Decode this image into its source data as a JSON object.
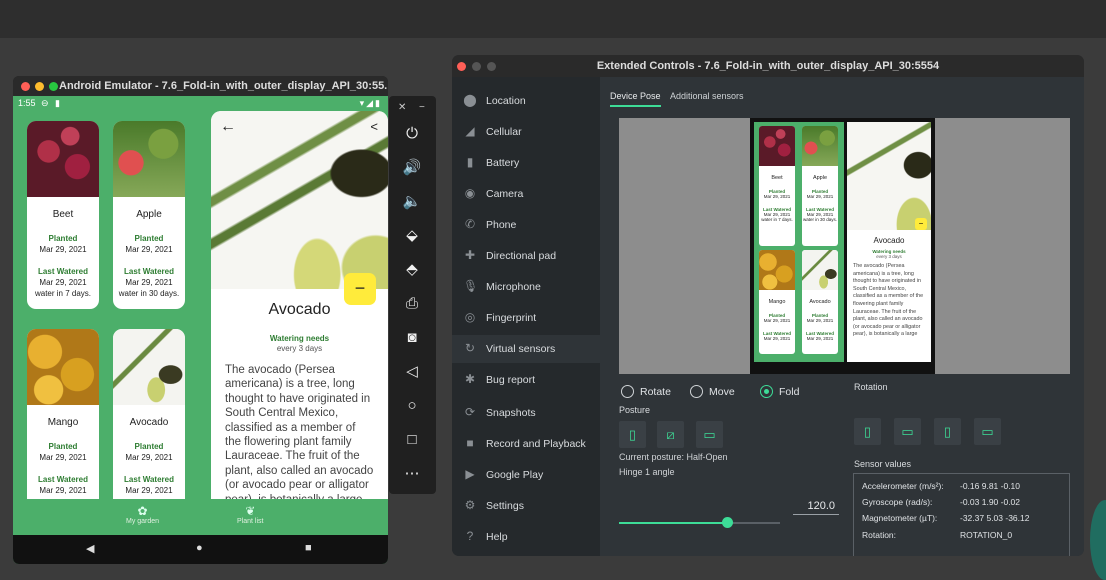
{
  "emulator": {
    "title": "Android Emulator - 7.6_Fold-in_with_outer_display_API_30:55...",
    "status_time": "1:55",
    "status_left_icons": "⊖ ▮",
    "status_right_icons": "▾◢▮",
    "plants": [
      {
        "name": "Beet",
        "planted_label": "Planted",
        "planted_date": "Mar 29, 2021",
        "watered_label": "Last Watered",
        "watered_date": "Mar 29, 2021",
        "watered_note": "water in 7 days."
      },
      {
        "name": "Apple",
        "planted_label": "Planted",
        "planted_date": "Mar 29, 2021",
        "watered_label": "Last Watered",
        "watered_date": "Mar 29, 2021",
        "watered_note": "water in 30 days."
      },
      {
        "name": "Mango",
        "planted_label": "Planted",
        "planted_date": "Mar 29, 2021",
        "watered_label": "Last Watered",
        "watered_date": "Mar 29, 2021"
      },
      {
        "name": "Avocado",
        "planted_label": "Planted",
        "planted_date": "Mar 29, 2021",
        "watered_label": "Last Watered",
        "watered_date": "Mar 29, 2021"
      }
    ],
    "detail": {
      "title": "Avocado",
      "watering_label": "Watering needs",
      "watering_value": "every 3 days",
      "description": "The avocado (Persea americana) is a tree, long thought to have originated in South Central Mexico, classified as a member of the flowering plant family Lauraceae. The fruit of the plant, also called an avocado (or avocado pear or alligator pear), is botanically a large",
      "fab": "−"
    },
    "bottom_nav": [
      {
        "label": "My garden",
        "icon": "✿"
      },
      {
        "label": "Plant list",
        "icon": "❦"
      }
    ]
  },
  "toolbar_icons": [
    "power-icon",
    "volume-up-icon",
    "volume-down-icon",
    "rotate-left-icon",
    "rotate-right-icon",
    "screenshot-icon",
    "camera-icon",
    "back-icon",
    "home-icon",
    "overview-icon",
    "more-icon"
  ],
  "extended": {
    "title": "Extended Controls - 7.6_Fold-in_with_outer_display_API_30:5554",
    "sidebar": [
      {
        "label": "Location",
        "icon": "location-icon"
      },
      {
        "label": "Cellular",
        "icon": "cellular-icon"
      },
      {
        "label": "Battery",
        "icon": "battery-icon"
      },
      {
        "label": "Camera",
        "icon": "camera-icon"
      },
      {
        "label": "Phone",
        "icon": "phone-icon"
      },
      {
        "label": "Directional pad",
        "icon": "dpad-icon"
      },
      {
        "label": "Microphone",
        "icon": "microphone-icon"
      },
      {
        "label": "Fingerprint",
        "icon": "fingerprint-icon"
      },
      {
        "label": "Virtual sensors",
        "icon": "sensors-icon"
      },
      {
        "label": "Bug report",
        "icon": "bug-icon"
      },
      {
        "label": "Snapshots",
        "icon": "snapshots-icon"
      },
      {
        "label": "Record and Playback",
        "icon": "record-icon"
      },
      {
        "label": "Google Play",
        "icon": "play-icon"
      },
      {
        "label": "Settings",
        "icon": "settings-icon"
      },
      {
        "label": "Help",
        "icon": "help-icon"
      }
    ],
    "tabs": [
      "Device Pose",
      "Additional sensors"
    ],
    "preview": {
      "left_plants": [
        {
          "name": "Beet",
          "planted": "Planted",
          "date": "Mar 29, 2021",
          "watered": "Last Watered",
          "wdate": "Mar 29, 2021",
          "note": "water in 7 days."
        },
        {
          "name": "Apple",
          "planted": "Planted",
          "date": "Mar 29, 2021",
          "watered": "Last Watered",
          "wdate": "Mar 29, 2021",
          "note": "water in 30 days."
        },
        {
          "name": "Mango",
          "planted": "Planted",
          "date": "Mar 29, 2021",
          "watered": "Last Watered",
          "wdate": "Mar 29, 2021",
          "note": ""
        },
        {
          "name": "Avocado",
          "planted": "Planted",
          "date": "Mar 29, 2021",
          "watered": "Last Watered",
          "wdate": "Mar 29, 2021",
          "note": ""
        }
      ],
      "title": "Avocado",
      "watering_label": "Watering needs",
      "watering_value": "every 3 days",
      "description": "The avocado (Persea americana) is a tree, long thought to have originated in South Central Mexico, classified as a member of the flowering plant family Lauraceae. The fruit of the plant, also called an avocado (or avocado pear or alligator pear), is botanically a large"
    },
    "modes": {
      "rotate": "Rotate",
      "move": "Move",
      "fold": "Fold",
      "selected": "Fold"
    },
    "posture_label": "Posture",
    "current_posture": "Current posture: Half-Open",
    "hinge_label": "Hinge 1 angle",
    "hinge_value": "120.0",
    "hinge_fraction": 0.67,
    "rotation_label": "Rotation",
    "sensor_label": "Sensor values",
    "sensors": [
      {
        "name": "Accelerometer (m/s²):",
        "value": "-0.16    9.81  -0.10"
      },
      {
        "name": "Gyroscope (rad/s):",
        "value": "-0.03    1.90  -0.02"
      },
      {
        "name": "Magnetometer (µT):",
        "value": "-32.37  5.03  -36.12"
      },
      {
        "name": "Rotation:",
        "value": "ROTATION_0"
      }
    ]
  },
  "colors": {
    "accent": "#3ddc97",
    "app_green": "#4caf6a",
    "fab": "#ffeb3b"
  }
}
